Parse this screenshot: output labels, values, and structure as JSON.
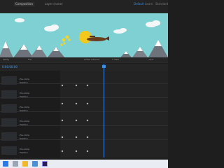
{
  "app": {
    "title": "Untitled Project",
    "tabs": [
      "Composition",
      "Layer (none)"
    ],
    "right_tabs": [
      "Default",
      "Learn",
      "Standard"
    ],
    "accent": "#2d8ceb"
  },
  "viewer": {
    "sky_color": "#7fd0d3",
    "cloud_color": "#f4f7f8",
    "mountain_color": "#7a7f88",
    "snow_color": "#ffffff",
    "sun_color": "#f2c81c",
    "plane_color": "#6b3d1f",
    "bar_items": [
      "(50%)",
      "Full",
      "Active Camera",
      "1 View",
      "+0.0"
    ]
  },
  "timeline": {
    "timecode": "0:00:00:00",
    "layers": [
      {
        "name": "Pre-comp",
        "sub": "Position"
      },
      {
        "name": "Pre-comp",
        "sub": "Position"
      },
      {
        "name": "Pre-comp",
        "sub": "Position"
      },
      {
        "name": "Pre-comp",
        "sub": "Position"
      },
      {
        "name": "Pre-comp",
        "sub": "Position"
      },
      {
        "name": "Pre-comp",
        "sub": "Position"
      }
    ],
    "playhead_color": "#3f8de3"
  },
  "taskbar": {
    "icons": [
      "windows-start-icon",
      "search-icon",
      "file-explorer-icon",
      "mail-icon",
      "after-effects-icon"
    ]
  }
}
